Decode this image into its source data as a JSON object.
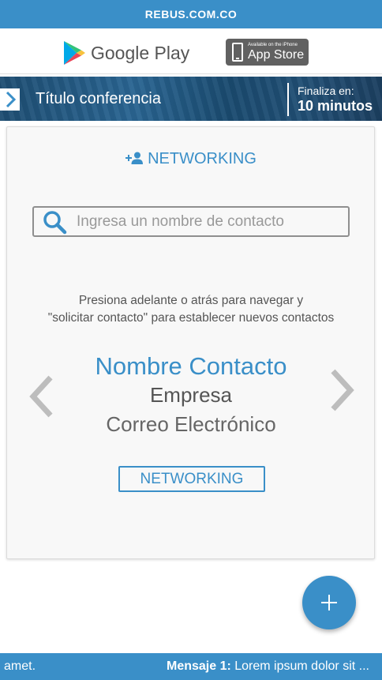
{
  "top_banner": {
    "site": "REBUS.COM.CO"
  },
  "stores": {
    "google_play": "Google Play",
    "app_store_small": "Available on the iPhone",
    "app_store_big": "App Store"
  },
  "conference": {
    "title": "Título conferencia",
    "ends_label": "Finaliza en:",
    "ends_value": "10 minutos"
  },
  "networking": {
    "heading": "NETWORKING",
    "search_placeholder": "Ingresa un nombre de contacto",
    "instructions_line1": "Presiona adelante o atrás para navegar y",
    "instructions_line2": "\"solicitar contacto\" para establecer nuevos contactos",
    "contact": {
      "name": "Nombre Contacto",
      "company": "Empresa",
      "email": "Correo Electrónico"
    },
    "button_label": "NETWORKING"
  },
  "fab": {
    "icon": "plus-icon"
  },
  "ticker": {
    "left_text": "amet.",
    "message_label": "Mensaje 1:",
    "message_text": " Lorem ipsum dolor sit ..."
  },
  "colors": {
    "accent": "#3a8fc8",
    "text_gray": "#555555",
    "arrow_gray": "#bdbdbd"
  }
}
